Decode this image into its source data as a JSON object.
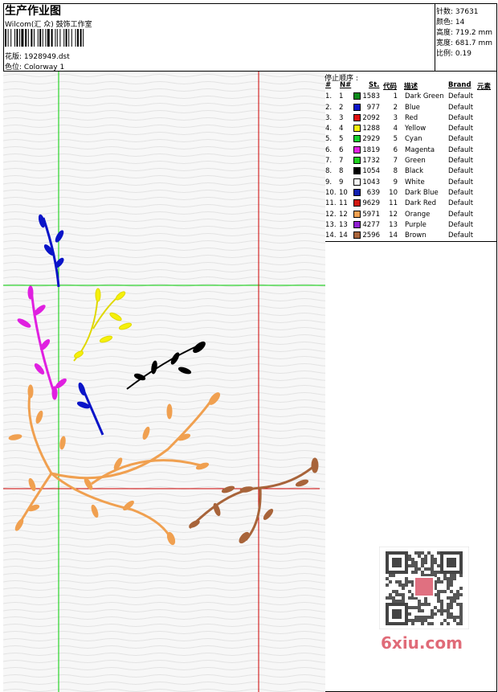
{
  "header": {
    "title": "生产作业图",
    "company": "Wilcom(汇 众) 鼓饰工作室",
    "design": "花版:  1928949.dst",
    "colorway": "色位:  Colorway 1"
  },
  "info": {
    "stitches": "针数:  37631",
    "colors": "颜色:  14",
    "height": "高度:  719.2 mm",
    "width": "宽度:  681.7 mm",
    "scale": "比例:  0.19"
  },
  "legend": {
    "title": "停止顺序 :",
    "headers": {
      "no": "#",
      "n": "N#",
      "st": "St.",
      "code": "代码",
      "desc": "描述",
      "brand": "Brand",
      "elem": "元素"
    },
    "rows": [
      {
        "no": "1.",
        "n": "1",
        "st": "1583",
        "code": "1",
        "desc": "Dark Green",
        "brand": "Default",
        "color": "#0a8a1a"
      },
      {
        "no": "2.",
        "n": "2",
        "st": "977",
        "code": "2",
        "desc": "Blue",
        "brand": "Default",
        "color": "#0a14c8"
      },
      {
        "no": "3.",
        "n": "3",
        "st": "2092",
        "code": "3",
        "desc": "Red",
        "brand": "Default",
        "color": "#e01010"
      },
      {
        "no": "4.",
        "n": "4",
        "st": "1288",
        "code": "4",
        "desc": "Yellow",
        "brand": "Default",
        "color": "#f5f00a"
      },
      {
        "no": "5.",
        "n": "5",
        "st": "2929",
        "code": "5",
        "desc": "Cyan",
        "brand": "Default",
        "color": "#18d030"
      },
      {
        "no": "6.",
        "n": "6",
        "st": "1819",
        "code": "6",
        "desc": "Magenta",
        "brand": "Default",
        "color": "#e020e0"
      },
      {
        "no": "7.",
        "n": "7",
        "st": "1732",
        "code": "7",
        "desc": "Green",
        "brand": "Default",
        "color": "#20d020"
      },
      {
        "no": "8.",
        "n": "8",
        "st": "1054",
        "code": "8",
        "desc": "Black",
        "brand": "Default",
        "color": "#000000"
      },
      {
        "no": "9.",
        "n": "9",
        "st": "1043",
        "code": "9",
        "desc": "White",
        "brand": "Default",
        "color": "#f4f4f4"
      },
      {
        "no": "10.",
        "n": "10",
        "st": "639",
        "code": "10",
        "desc": "Dark Blue",
        "brand": "Default",
        "color": "#1020b0"
      },
      {
        "no": "11.",
        "n": "11",
        "st": "9629",
        "code": "11",
        "desc": "Dark Red",
        "brand": "Default",
        "color": "#d01810"
      },
      {
        "no": "12.",
        "n": "12",
        "st": "5971",
        "code": "12",
        "desc": "Orange",
        "brand": "Default",
        "color": "#f0a050"
      },
      {
        "no": "13.",
        "n": "13",
        "st": "4277",
        "code": "13",
        "desc": "Purple",
        "brand": "Default",
        "color": "#9020d0"
      },
      {
        "no": "14.",
        "n": "14",
        "st": "2596",
        "code": "14",
        "desc": "Brown",
        "brand": "Default",
        "color": "#a8643a"
      }
    ]
  },
  "watermark": {
    "site": "6xiu.com"
  },
  "colors": {
    "guide_green": "#00cc00",
    "guide_red": "#cc0000",
    "orange": "#f0a050",
    "brown": "#a8643a",
    "magenta": "#e020e0",
    "yellow": "#f5f00a",
    "blue": "#0a14c8",
    "black": "#000000"
  }
}
